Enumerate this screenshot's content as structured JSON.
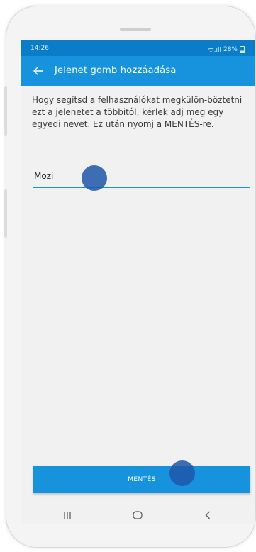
{
  "status_bar": {
    "time": "14:26",
    "battery": "28%",
    "signal_text": "ᯤ.ıll"
  },
  "app_bar": {
    "title": "Jelenet gomb hozzáadása"
  },
  "description": "Hogy segítsd a felhasználókat megkülön-böztetni ezt a jelenetet a többitől, kérlek adj meg egy egyedi nevet. Ez után nyomj a MENTÉS-re.",
  "name_field": {
    "value": "Mozi"
  },
  "save_button": {
    "label": "MENTÉS"
  },
  "icons": {
    "back": "arrow-left-icon",
    "recents": "recent-apps-icon",
    "home": "home-icon",
    "nav_back": "chevron-left-icon"
  },
  "colors": {
    "primary": "#1793de",
    "status_bar": "#0a7cc8",
    "tap_indicator": "#1f56a8"
  }
}
